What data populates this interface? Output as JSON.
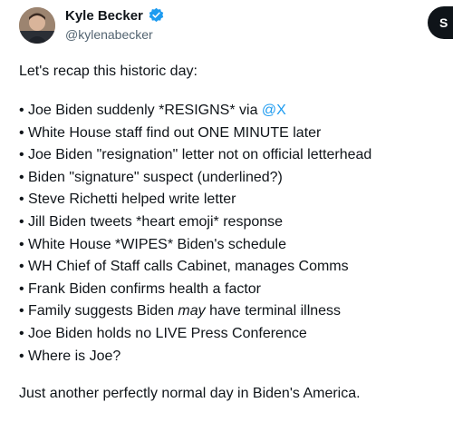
{
  "author": {
    "name": "Kyle Becker",
    "handle": "@kylenabecker",
    "verified": true,
    "avatar_icon": "profile-photo"
  },
  "actions": {
    "subscribe_label": "S"
  },
  "tweet": {
    "intro": "Let's recap this historic day:",
    "bullet_char": "•",
    "items": [
      {
        "pre": "Joe Biden suddenly *RESIGNS* via ",
        "mention": "@X",
        "em": "",
        "post": ""
      },
      {
        "pre": "White House staff find out ONE MINUTE later",
        "mention": "",
        "em": "",
        "post": ""
      },
      {
        "pre": "Joe Biden \"resignation\" letter not on official letterhead",
        "mention": "",
        "em": "",
        "post": ""
      },
      {
        "pre": "Biden \"signature\" suspect (underlined?)",
        "mention": "",
        "em": "",
        "post": ""
      },
      {
        "pre": "Steve Richetti helped write letter",
        "mention": "",
        "em": "",
        "post": ""
      },
      {
        "pre": "Jill Biden tweets *heart emoji* response",
        "mention": "",
        "em": "",
        "post": ""
      },
      {
        "pre": "White House *WIPES* Biden's schedule",
        "mention": "",
        "em": "",
        "post": ""
      },
      {
        "pre": "WH Chief of Staff calls Cabinet, manages Comms",
        "mention": "",
        "em": "",
        "post": ""
      },
      {
        "pre": "Frank Biden confirms health a factor",
        "mention": "",
        "em": "",
        "post": ""
      },
      {
        "pre": "Family suggests Biden ",
        "mention": "",
        "em": "may",
        "post": " have terminal illness"
      },
      {
        "pre": "Joe Biden holds no LIVE Press Conference",
        "mention": "",
        "em": "",
        "post": ""
      },
      {
        "pre": "Where is Joe?",
        "mention": "",
        "em": "",
        "post": ""
      }
    ],
    "outro": "Just another perfectly normal day in Biden's America."
  },
  "colors": {
    "text": "#0f1419",
    "secondary": "#536471",
    "link": "#1d9bf0",
    "verified_badge": "#1d9bf0"
  }
}
